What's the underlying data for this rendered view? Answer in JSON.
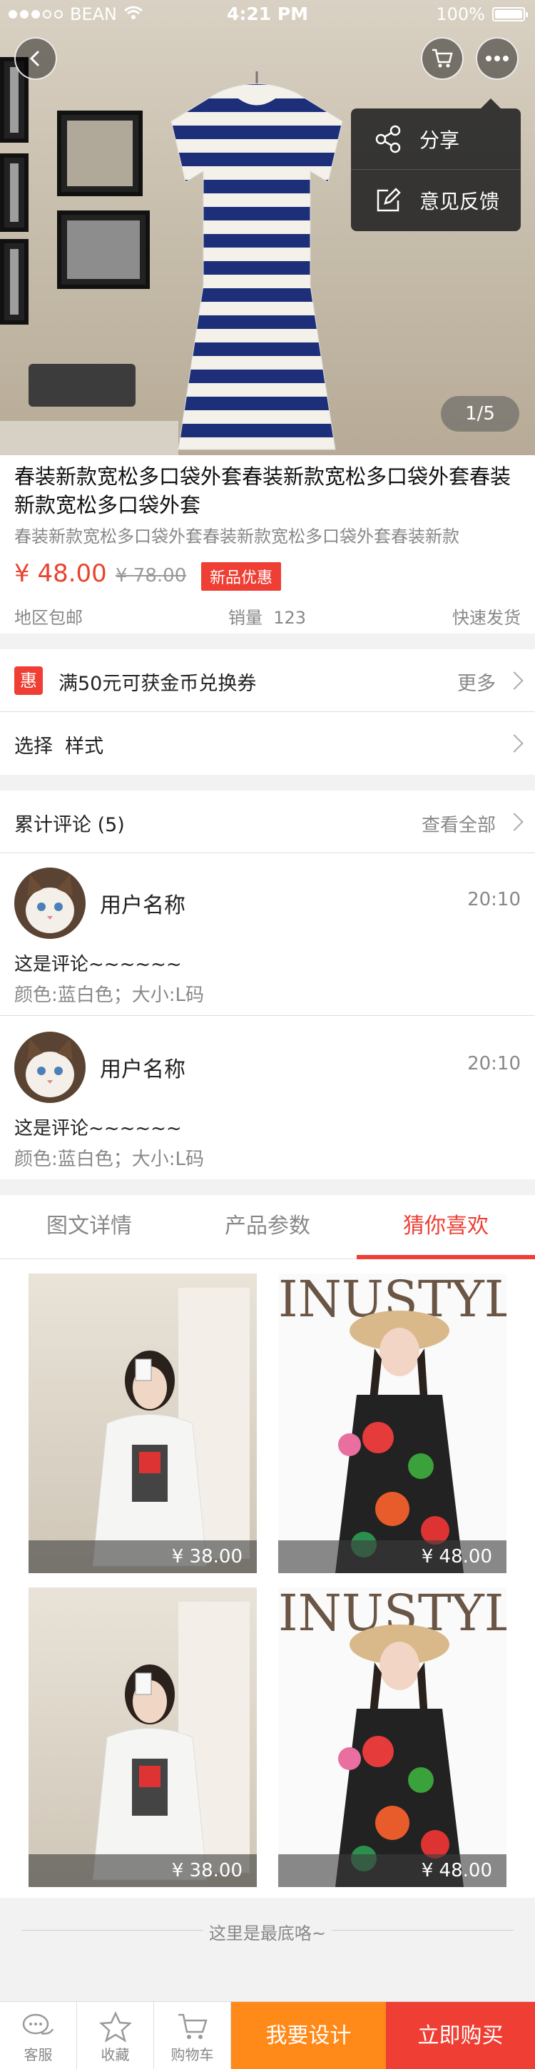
{
  "status_bar": {
    "carrier": "BEAN",
    "time": "4:21 PM",
    "battery": "100%"
  },
  "hero": {
    "image_counter": "1/5"
  },
  "popup_menu": {
    "items": [
      {
        "label": "分享",
        "icon": "share-icon"
      },
      {
        "label": "意见反馈",
        "icon": "edit-icon"
      }
    ]
  },
  "product": {
    "title": "春装新款宽松多口袋外套春装新款宽松多口袋外套春装新款宽松多口袋外套",
    "subtitle": "春装新款宽松多口袋外套春装新款宽松多口袋外套春装新款",
    "price": "¥ 48.00",
    "old_price": "¥ 78.00",
    "badge": "新品优惠",
    "shipping": "地区包邮",
    "sales_label": "销量",
    "sales_count": "123",
    "delivery": "快速发货"
  },
  "promo": {
    "icon_text": "惠",
    "text": "满50元可获金币兑换券",
    "more": "更多"
  },
  "select": {
    "label": "选择",
    "value": "样式"
  },
  "reviews": {
    "title": "累计评论",
    "count": "(5)",
    "view_all": "查看全部",
    "items": [
      {
        "user": "用户名称",
        "time": "20:10",
        "text": "这是评论~~~~~~",
        "spec": "颜色:蓝白色；大小:L码"
      },
      {
        "user": "用户名称",
        "time": "20:10",
        "text": "这是评论~~~~~~",
        "spec": "颜色:蓝白色；大小:L码"
      }
    ]
  },
  "tabs": [
    {
      "label": "图文详情"
    },
    {
      "label": "产品参数"
    },
    {
      "label": "猜你喜欢",
      "active": true
    }
  ],
  "recommend": {
    "items": [
      {
        "price": "¥ 38.00"
      },
      {
        "price": "¥ 48.00",
        "brand_text": "INUSTYLE"
      },
      {
        "price": "¥ 38.00"
      },
      {
        "price": "¥ 48.00",
        "brand_text": "INUSTYLE"
      }
    ]
  },
  "end_note": "这里是最底咯~",
  "bottom_bar": {
    "service": "客服",
    "favorite": "收藏",
    "cart": "购物车",
    "design": "我要设计",
    "buy": "立即购买"
  },
  "colors": {
    "accent_red": "#ef3e33",
    "accent_orange": "#ff8a1a"
  }
}
